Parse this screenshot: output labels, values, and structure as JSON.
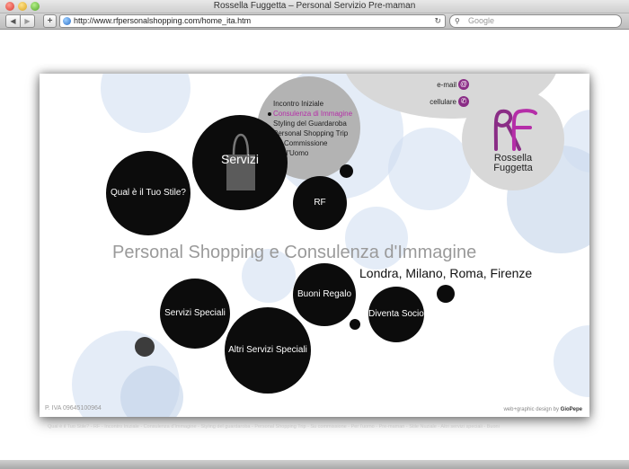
{
  "window": {
    "title": "Rossella Fuggetta – Personal Servizio Pre-maman"
  },
  "toolbar": {
    "back_glyph": "◀",
    "forward_glyph": "▶",
    "add_glyph": "+",
    "url": "http://www.rfpersonalshopping.com/home_ita.htm",
    "reload_glyph": "↻",
    "search_placeholder": "Google"
  },
  "menu": {
    "items": [
      {
        "label": "Incontro Iniziale",
        "active": false
      },
      {
        "label": "Consulenza di Immagine",
        "active": true
      },
      {
        "label": "Styling del Guardaroba",
        "active": false
      },
      {
        "label": "Personal Shopping Trip",
        "active": false
      },
      {
        "label": "Su Commissione",
        "active": false
      },
      {
        "label": "Per l'Uomo",
        "active": false
      }
    ]
  },
  "contact": {
    "email_label": "e-mail",
    "phone_label": "cellulare"
  },
  "logo": {
    "line1": "Rossella",
    "line2": "Fuggetta"
  },
  "bubbles": {
    "stile": "Qual è il Tuo Stile?",
    "servizi": "Servizi",
    "rf": "RF",
    "buoni": "Buoni Regalo",
    "speciali": "Servizi Speciali",
    "socio": "Diventa Socio",
    "altri": "Altri Servizi Speciali"
  },
  "main": {
    "tagline": "Personal Shopping e Consulenza d'Immagine",
    "cities": "Londra, Milano, Roma, Firenze"
  },
  "footer": {
    "piva": "P. IVA  09645100964",
    "credit_prefix": "web+graphic design by",
    "credit_name": "GioPepe",
    "links": "Qual è il Tuo Stile? - RF - Incontro Iniziale - Consulenza d'Immagine - Styling del guardaroba - Personal Shopping Trip - Su commissione - Per l'uomo - Pre-maman - Stile Nuziale - Altri servizi speciali - Buoni"
  },
  "colors": {
    "accent_purple": "#b52ea8",
    "bubble_black": "#0c0c0c",
    "pale_blue": "#cddcf0"
  }
}
